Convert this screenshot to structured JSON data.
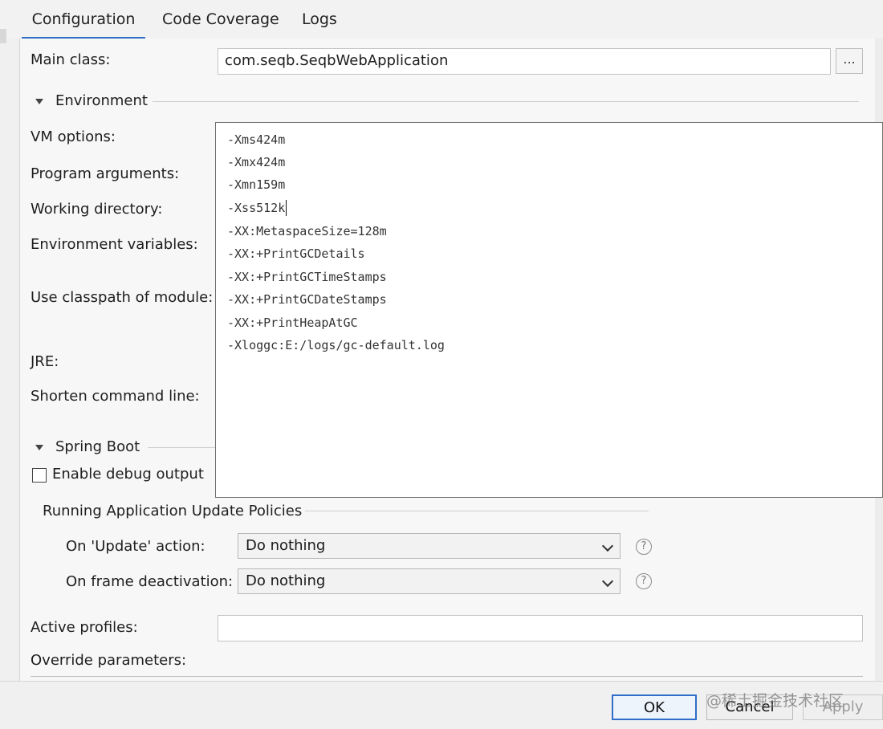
{
  "tabs": [
    {
      "label": "Configuration"
    },
    {
      "label": "Code Coverage"
    },
    {
      "label": "Logs"
    }
  ],
  "form": {
    "main_class_label": "Main class:",
    "main_class_value": "com.seqb.SeqbWebApplication",
    "browse_label": "...",
    "environment_label": "Environment",
    "vm_options_label": "VM options:",
    "program_arguments_label": "Program arguments:",
    "working_directory_label": "Working directory:",
    "environment_variables_label": "Environment variables:",
    "classpath_module_label": "Use classpath of module:",
    "jre_label": "JRE:",
    "shorten_command_label": "Shorten command line:",
    "spring_boot_label": "Spring Boot",
    "enable_debug_label": "Enable debug output",
    "update_policies_label": "Running Application Update Policies",
    "on_update_label": "On 'Update' action:",
    "on_update_value": "Do nothing",
    "on_frame_label": "On frame deactivation:",
    "on_frame_value": "Do nothing",
    "active_profiles_label": "Active profiles:",
    "active_profiles_value": "",
    "override_parameters_label": "Override parameters:"
  },
  "vm_options_lines": [
    "-Xms424m",
    "-Xmx424m",
    "-Xmn159m",
    "-Xss512k",
    "-XX:MetaspaceSize=128m",
    "-XX:+PrintGCDetails",
    "-XX:+PrintGCTimeStamps",
    "-XX:+PrintGCDateStamps",
    "-XX:+PrintHeapAtGC",
    "-Xloggc:E:/logs/gc-default.log"
  ],
  "buttons": {
    "ok": "OK",
    "cancel": "Cancel",
    "apply": "Apply"
  },
  "watermark": "@稀土掘金技术社区",
  "icons": {
    "help": "question-circle-icon",
    "expand": "triangle-down-icon",
    "dropdown": "chevron-down-icon"
  }
}
